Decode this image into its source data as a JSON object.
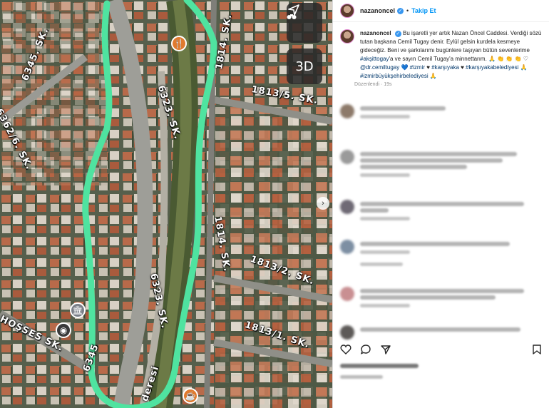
{
  "map": {
    "streets": [
      {
        "text": "6345. SK."
      },
      {
        "text": "6362/6. SK."
      },
      {
        "text": "6323. SK."
      },
      {
        "text": "6323. SK."
      },
      {
        "text": "1813/5. SK."
      },
      {
        "text": "1814. SK."
      },
      {
        "text": "1814. SK."
      },
      {
        "text": "1813/2. SK."
      },
      {
        "text": "1813/1. SK."
      },
      {
        "text": "HOŞSES SK."
      },
      {
        "text": "6345"
      },
      {
        "text": "deresi"
      }
    ],
    "button_3d": "3D",
    "colors": {
      "highlight": "#4fe3a0"
    }
  },
  "post": {
    "username": "nazanoncel",
    "follow_label": "Takip Et",
    "caption_user": "nazanoncel",
    "caption_parts": [
      "Bu işaretli yer artık Nazan Öncel Caddesi. Verdiği sözü tutan başkana Cemil Tugay denir. Eylül gelsin kurdela kesmeye gideceğiz. Beni ve şarkılarımı bugünlere taşıyan bütün sevenlerime ",
      "#akşittogay",
      "'a ve sayın Cemil Tugay'a minnettarım. 🙏 👏 👏 👏 ♡ ",
      "@dr.cemiltugay",
      " 💙 ",
      "#izmir",
      " ♥ ",
      "#karşıyaka",
      " ♥ ",
      "#karşıyakabelediyesi",
      " 🙏 ",
      "#izmirbüyükşehirbelediyesi",
      " 🙏"
    ],
    "edited": "Düzenlendi · 19s"
  }
}
